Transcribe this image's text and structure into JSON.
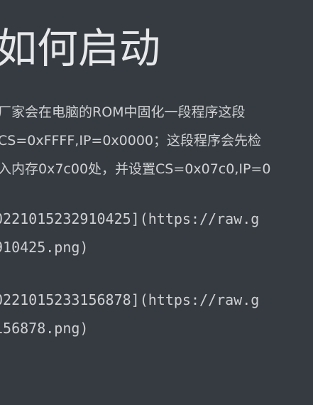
{
  "heading": "如何启动",
  "paragraph_lines": [
    "厂家会在电脑的ROM中固化一段程序这段",
    "CS=0xFFFF,IP=0x0000；这段程序会先检",
    "入内存0x7c00处，并设置CS=0x07c0,IP=0"
  ],
  "image_links": [
    {
      "line1": "0221015232910425](https://raw.g",
      "line2": "910425.png)"
    },
    {
      "line1": "0221015233156878](https://raw.g",
      "line2": "156878.png)"
    }
  ]
}
